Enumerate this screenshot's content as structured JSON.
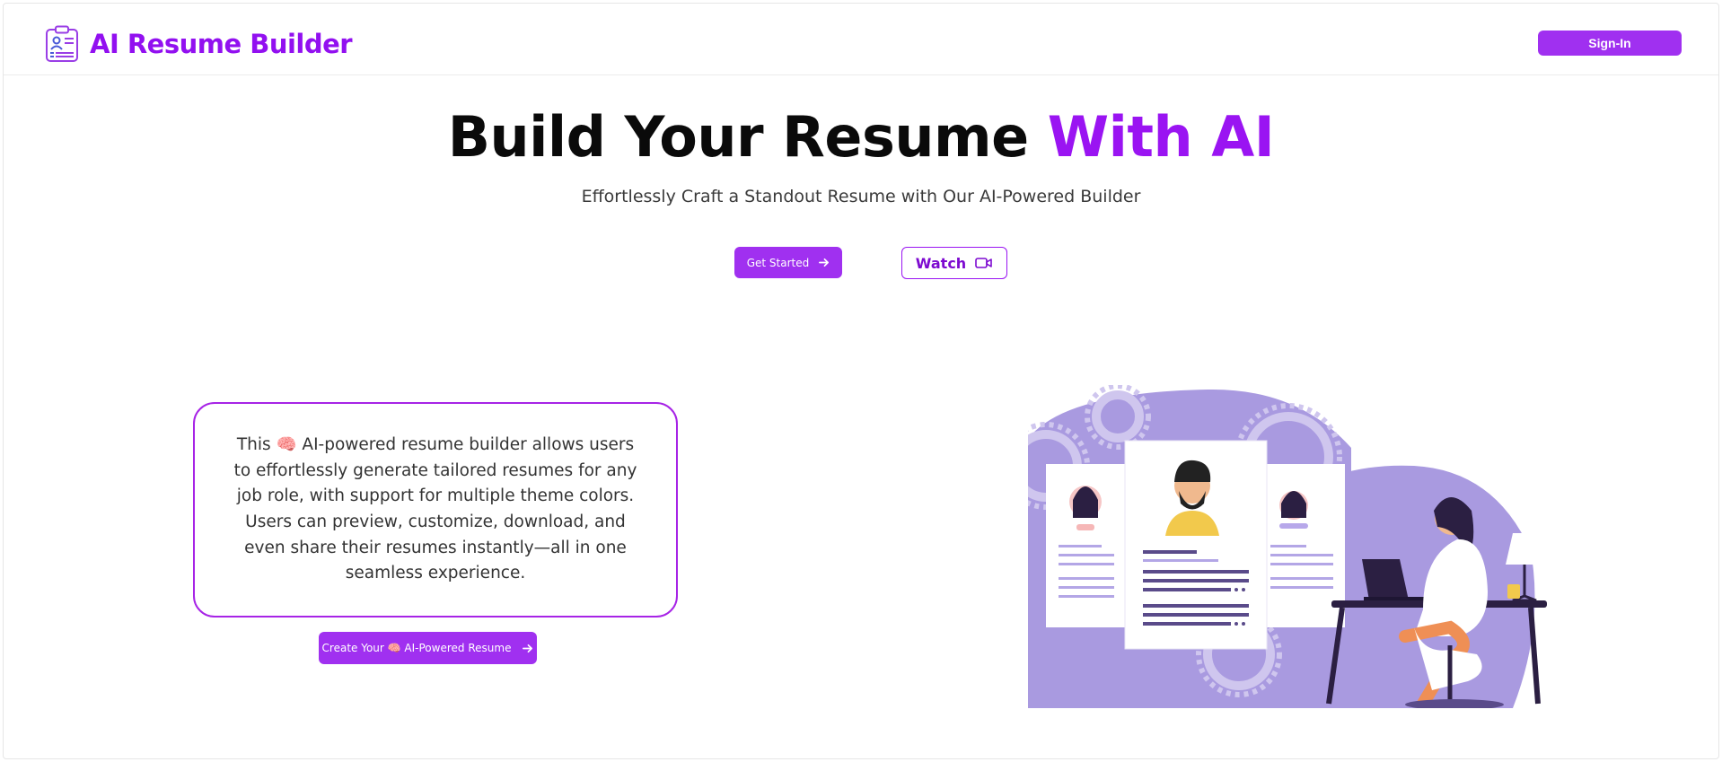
{
  "header": {
    "brand_name": "AI Resume Builder",
    "brand_icon": "resume-clipboard-icon",
    "signin_label": "Sign-In"
  },
  "hero": {
    "title_main": "Build Your Resume ",
    "title_accent": "With AI",
    "subtitle": "Effortlessly Craft a Standout Resume with Our AI-Powered Builder",
    "get_started_label": "Get Started",
    "watch_label": "Watch"
  },
  "intro": {
    "description_before": "This ",
    "description_emoji": "🧠",
    "description_after": " AI-powered resume builder allows users to effortlessly generate tailored resumes for any job role, with support for multiple theme colors. Users can preview, customize, download, and even share their resumes instantly—all in one seamless experience.",
    "create_label_before": "Create Your ",
    "create_emoji": "🧠",
    "create_label_after": " AI-Powered Resume"
  },
  "colors": {
    "brand": "#9210f0",
    "accent": "#9a14f2",
    "button": "#a030f0",
    "illustration_primary": "#a99ae0"
  }
}
